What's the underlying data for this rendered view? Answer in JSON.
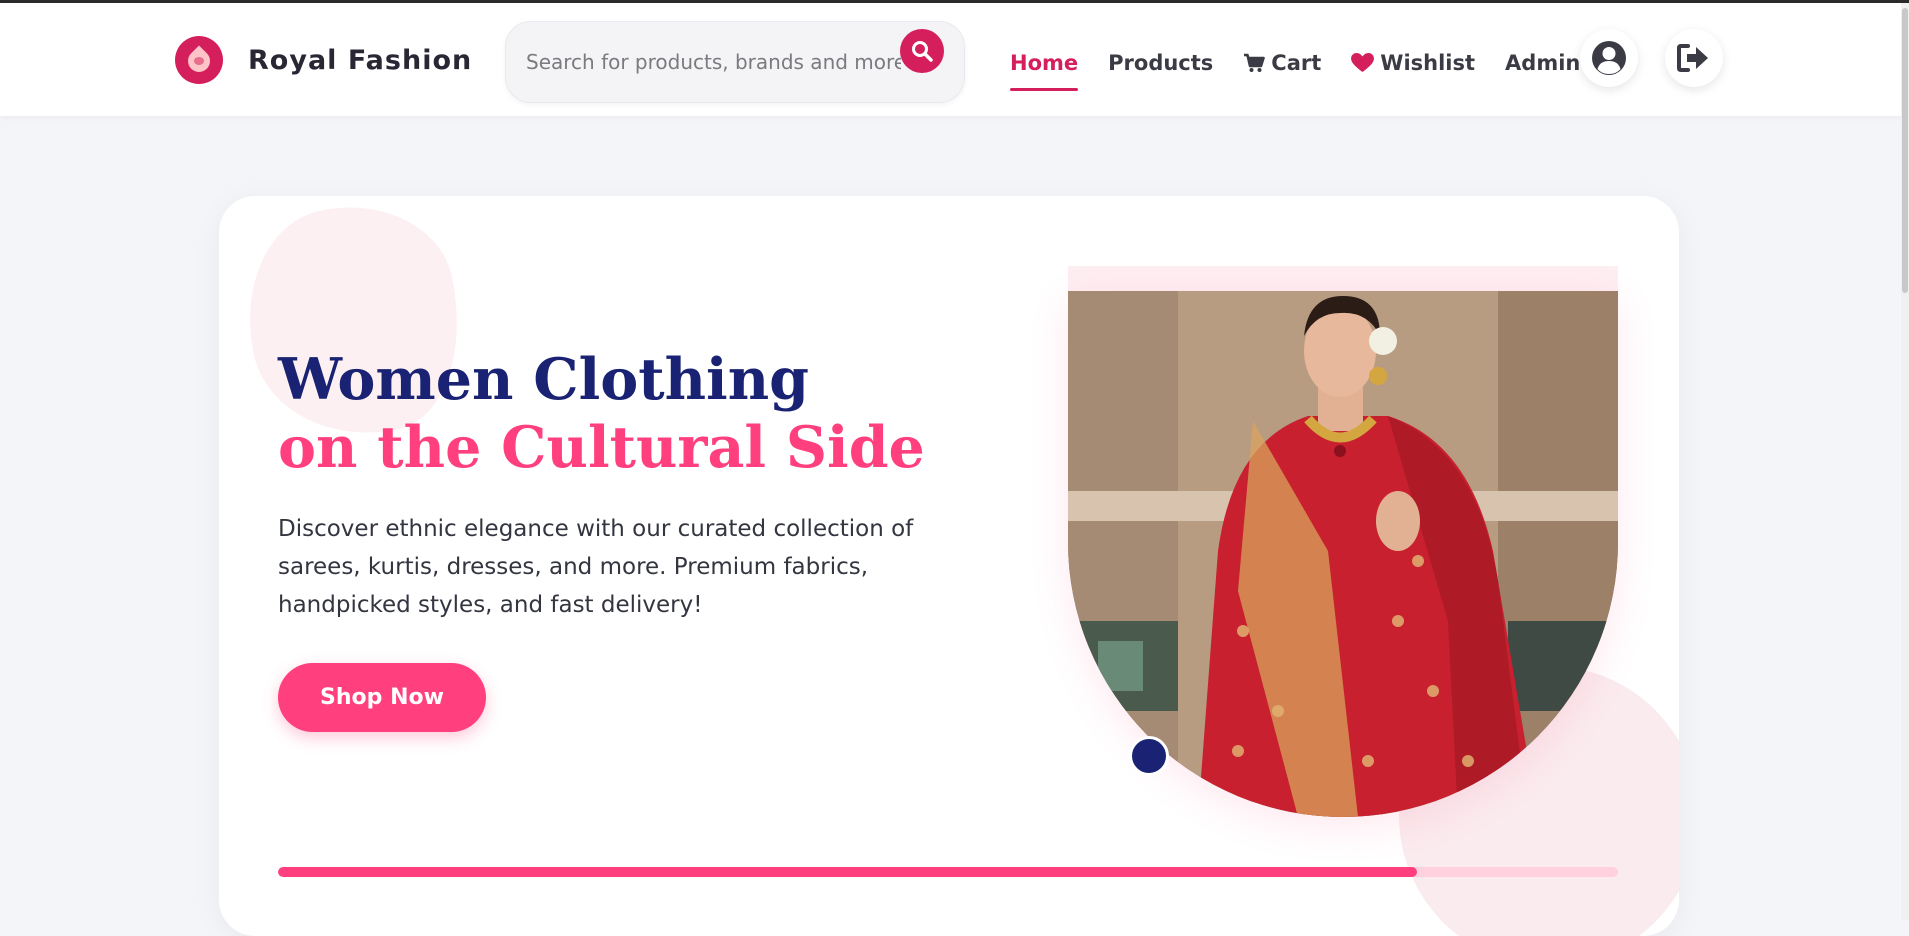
{
  "brand": {
    "name": "Royal Fashion",
    "icon": "lotus-logo-icon",
    "color": "#d41f5c"
  },
  "search": {
    "placeholder": "Search for products, brands and more",
    "button_icon": "search-icon"
  },
  "nav": {
    "items": [
      {
        "label": "Home",
        "icon": "",
        "active": true
      },
      {
        "label": "Products",
        "icon": "",
        "active": false
      },
      {
        "label": "Cart",
        "icon": "cart-icon",
        "active": false
      },
      {
        "label": "Wishlist",
        "icon": "heart-icon",
        "active": false
      },
      {
        "label": "Admin",
        "icon": "",
        "active": false
      }
    ],
    "user_icon": "user-circle-icon",
    "logout_icon": "logout-icon"
  },
  "hero": {
    "title_line1": "Women Clothing",
    "title_line2": "on the Cultural Side",
    "description": "Discover ethnic elegance with our curated collection of sarees, kurtis, dresses, and more. Premium fabrics, handpicked styles, and fast delivery!",
    "cta_label": "Shop Now",
    "image_subject": "woman in red saree",
    "progress_fraction": 0.85
  },
  "colors": {
    "accent": "#ff3f7e",
    "navy": "#1a2373",
    "brand_red": "#d41f5c"
  }
}
